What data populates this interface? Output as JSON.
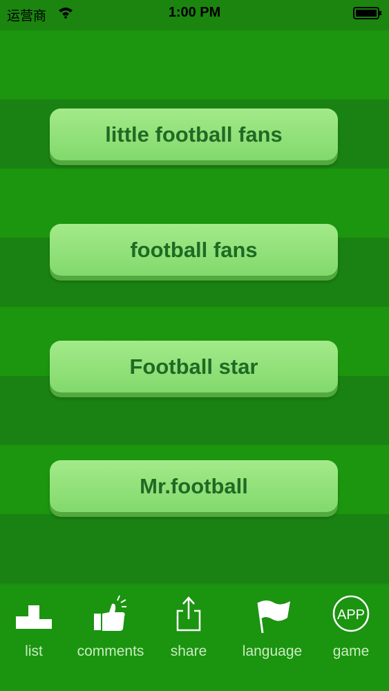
{
  "status_bar": {
    "carrier": "运营商",
    "time": "1:00 PM"
  },
  "menu": {
    "buttons": [
      {
        "label": "little football fans"
      },
      {
        "label": "football fans"
      },
      {
        "label": "Football star"
      },
      {
        "label": "Mr.football"
      }
    ]
  },
  "tab_bar": {
    "items": [
      {
        "label": "list",
        "icon": "podium-icon"
      },
      {
        "label": "comments",
        "icon": "thumbs-up-icon"
      },
      {
        "label": "share",
        "icon": "share-icon"
      },
      {
        "label": "language",
        "icon": "flag-icon"
      },
      {
        "label": "game",
        "icon": "app-icon",
        "icon_text": "APP"
      }
    ]
  },
  "colors": {
    "field_light": "#1b960e",
    "field_dark": "#1a8212",
    "button_fill": "#92e27b",
    "button_text": "#1f6a24",
    "tab_label": "#c9eec0"
  }
}
